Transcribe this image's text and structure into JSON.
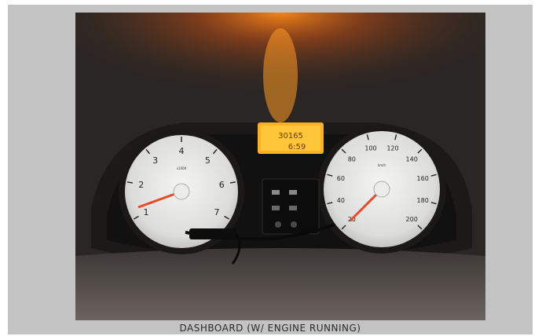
{
  "caption": "DASHBOARD (W/ ENGINE RUNNING)",
  "tachometer": {
    "ticks": [
      "1",
      "2",
      "3",
      "4",
      "5",
      "6",
      "7"
    ],
    "unit": "x1000"
  },
  "speedometer": {
    "ticks": [
      "20",
      "40",
      "60",
      "80",
      "100",
      "120",
      "140",
      "160",
      "180",
      "200"
    ],
    "unit": "km/h"
  },
  "display": {
    "odometer": "30165",
    "trip": "6:59"
  },
  "colors": {
    "frame": "#c3c3c3",
    "backlight": "#ff9a1a",
    "needle": "#e84a2a"
  }
}
